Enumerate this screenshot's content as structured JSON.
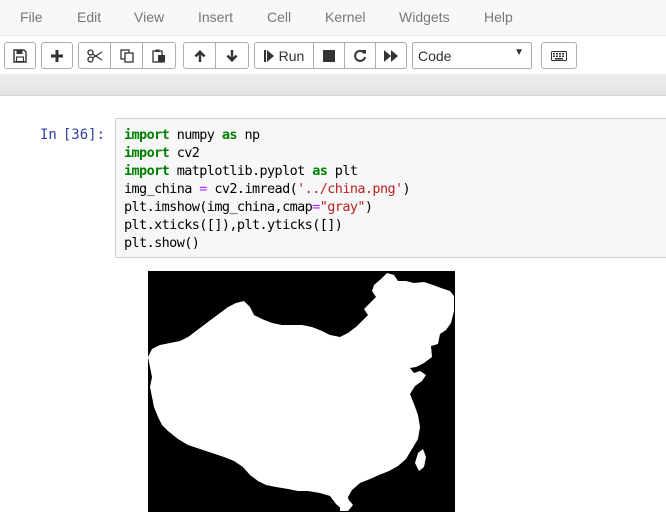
{
  "menubar": {
    "items": [
      "File",
      "Edit",
      "View",
      "Insert",
      "Cell",
      "Kernel",
      "Widgets",
      "Help"
    ]
  },
  "toolbar": {
    "run_label": "Run",
    "cell_type": "Code"
  },
  "cell": {
    "prompt_label": "In",
    "prompt_number": "[36]:",
    "code": [
      [
        {
          "t": "kw",
          "v": "import"
        },
        {
          "t": "n",
          "v": " numpy "
        },
        {
          "t": "kw",
          "v": "as"
        },
        {
          "t": "n",
          "v": " np"
        }
      ],
      [
        {
          "t": "kw",
          "v": "import"
        },
        {
          "t": "n",
          "v": " cv2"
        }
      ],
      [
        {
          "t": "kw",
          "v": "import"
        },
        {
          "t": "n",
          "v": " matplotlib.pyplot "
        },
        {
          "t": "kw",
          "v": "as"
        },
        {
          "t": "n",
          "v": " plt"
        }
      ],
      [
        {
          "t": "n",
          "v": "img_china "
        },
        {
          "t": "op",
          "v": "="
        },
        {
          "t": "n",
          "v": " cv2.imread("
        },
        {
          "t": "str",
          "v": "'../china.png'"
        },
        {
          "t": "n",
          "v": ")"
        }
      ],
      [
        {
          "t": "n",
          "v": "plt.imshow(img_china,cmap"
        },
        {
          "t": "op",
          "v": "="
        },
        {
          "t": "str",
          "v": "\"gray\""
        },
        {
          "t": "n",
          "v": ")"
        }
      ],
      [
        {
          "t": "n",
          "v": "plt.xticks([]),plt.yticks([])"
        }
      ],
      [
        {
          "t": "n",
          "v": "plt.show()"
        }
      ]
    ]
  },
  "output": {
    "image_description": "china-map-silhouette"
  }
}
